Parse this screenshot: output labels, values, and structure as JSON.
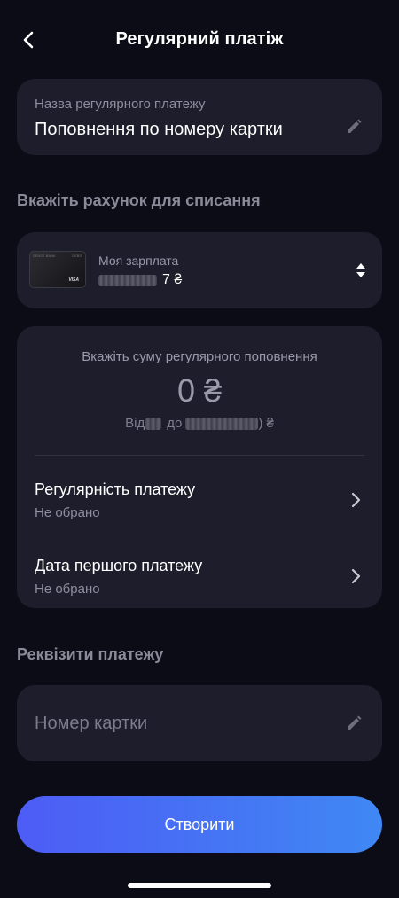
{
  "header": {
    "title": "Регулярний платіж",
    "back_icon": "chevron-left-icon"
  },
  "payment_name": {
    "label": "Назва регулярного платежу",
    "value": "Поповнення по номеру картки",
    "edit_icon": "pencil-icon"
  },
  "account_section": {
    "title": "Вкажіть рахунок для списання",
    "account_name": "Моя зарплата",
    "balance_currency": "7 ₴",
    "card_brand": "VISA",
    "card_bank": "SENSE BANK",
    "card_type": "DEBIT",
    "switch_icon": "sort-arrows-icon"
  },
  "amount": {
    "hint": "Вкажіть суму регулярного поповнення",
    "value": "0 ₴",
    "range_from": "Від",
    "range_to": "до",
    "range_currency": ") ₴"
  },
  "regularity": {
    "title": "Регулярність платежу",
    "value": "Не обрано"
  },
  "first_payment_date": {
    "title": "Дата першого платежу",
    "value": "Не обрано"
  },
  "requisites_section": {
    "title": "Реквізити платежу",
    "card_number_placeholder": "Номер картки"
  },
  "actions": {
    "create_label": "Створити"
  },
  "colors": {
    "background": "#0b0c16",
    "card": "#1d1d2b",
    "button_gradient_start": "#4d5cf5",
    "button_gradient_end": "#3f88f4"
  }
}
